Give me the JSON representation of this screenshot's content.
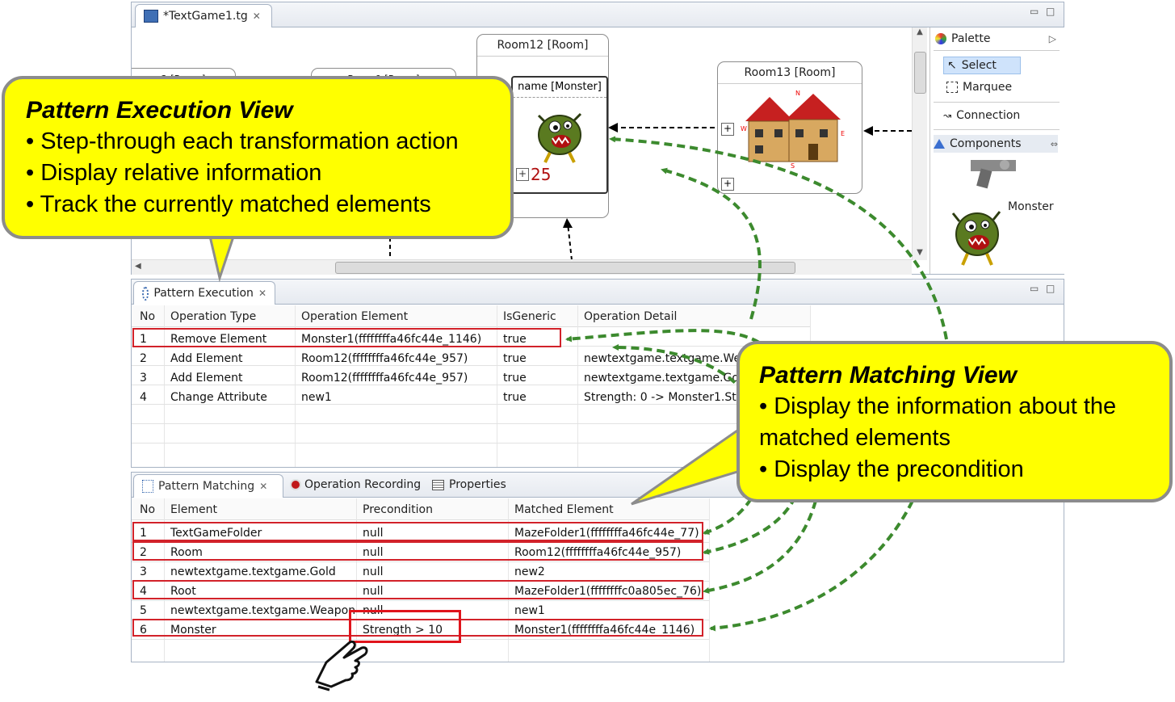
{
  "editor": {
    "tab_title": "*TextGame1.tg",
    "rooms": {
      "room12_title": "Room12 [Room]",
      "room13_title": "Room13 [Room]",
      "monster_title": "name [Monster]",
      "monster_value": "25",
      "partial_left": "2 [Room]",
      "partial_mid": "Room9 [Room]"
    }
  },
  "palette": {
    "title": "Palette",
    "items": [
      "Select",
      "Marquee",
      "Connection"
    ],
    "components_label": "Components",
    "monster_label": "Monster"
  },
  "pattern_execution": {
    "tab_label": "Pattern Execution",
    "columns": [
      "No",
      "Operation Type",
      "Operation Element",
      "IsGeneric",
      "Operation Detail"
    ],
    "rows": [
      [
        "1",
        "Remove Element",
        "Monster1(ffffffffa46fc44e_1146)",
        "true",
        ""
      ],
      [
        "2",
        "Add Element",
        "Room12(ffffffffa46fc44e_957)",
        "true",
        "newtextgame.textgame.Weap"
      ],
      [
        "3",
        "Add Element",
        "Room12(ffffffffa46fc44e_957)",
        "true",
        "newtextgame.textgame.Gold"
      ],
      [
        "4",
        "Change Attribute",
        "new1",
        "true",
        "Strength: 0 -> Monster1.Stre"
      ]
    ]
  },
  "pattern_matching": {
    "tabs": [
      "Pattern Matching",
      "Operation Recording",
      "Properties"
    ],
    "columns": [
      "No",
      "Element",
      "Precondition",
      "Matched Element"
    ],
    "rows": [
      [
        "1",
        "TextGameFolder",
        "null",
        "MazeFolder1(ffffffffa46fc44e_77)"
      ],
      [
        "2",
        "Room",
        "null",
        "Room12(ffffffffa46fc44e_957)"
      ],
      [
        "3",
        "newtextgame.textgame.Gold",
        "null",
        "new2"
      ],
      [
        "4",
        "Root",
        "null",
        "MazeFolder1(ffffffffc0a805ec_76)"
      ],
      [
        "5",
        "newtextgame.textgame.Weapon",
        "null",
        "new1"
      ],
      [
        "6",
        "Monster",
        "Strength > 10",
        "Monster1(ffffffffa46fc44e_1146)"
      ]
    ]
  },
  "callouts": {
    "execution": {
      "title": "Pattern Execution View",
      "bullets": [
        "• Step-through each transformation action",
        "• Display relative information",
        "• Track the currently matched elements"
      ]
    },
    "matching": {
      "title": "Pattern Matching View",
      "bullets": [
        "• Display the information about the",
        "matched elements",
        "• Display the precondition"
      ]
    }
  },
  "colors": {
    "callout": "#ffff00",
    "highlight": "#d2222a",
    "arrow": "#3c8a2e"
  }
}
